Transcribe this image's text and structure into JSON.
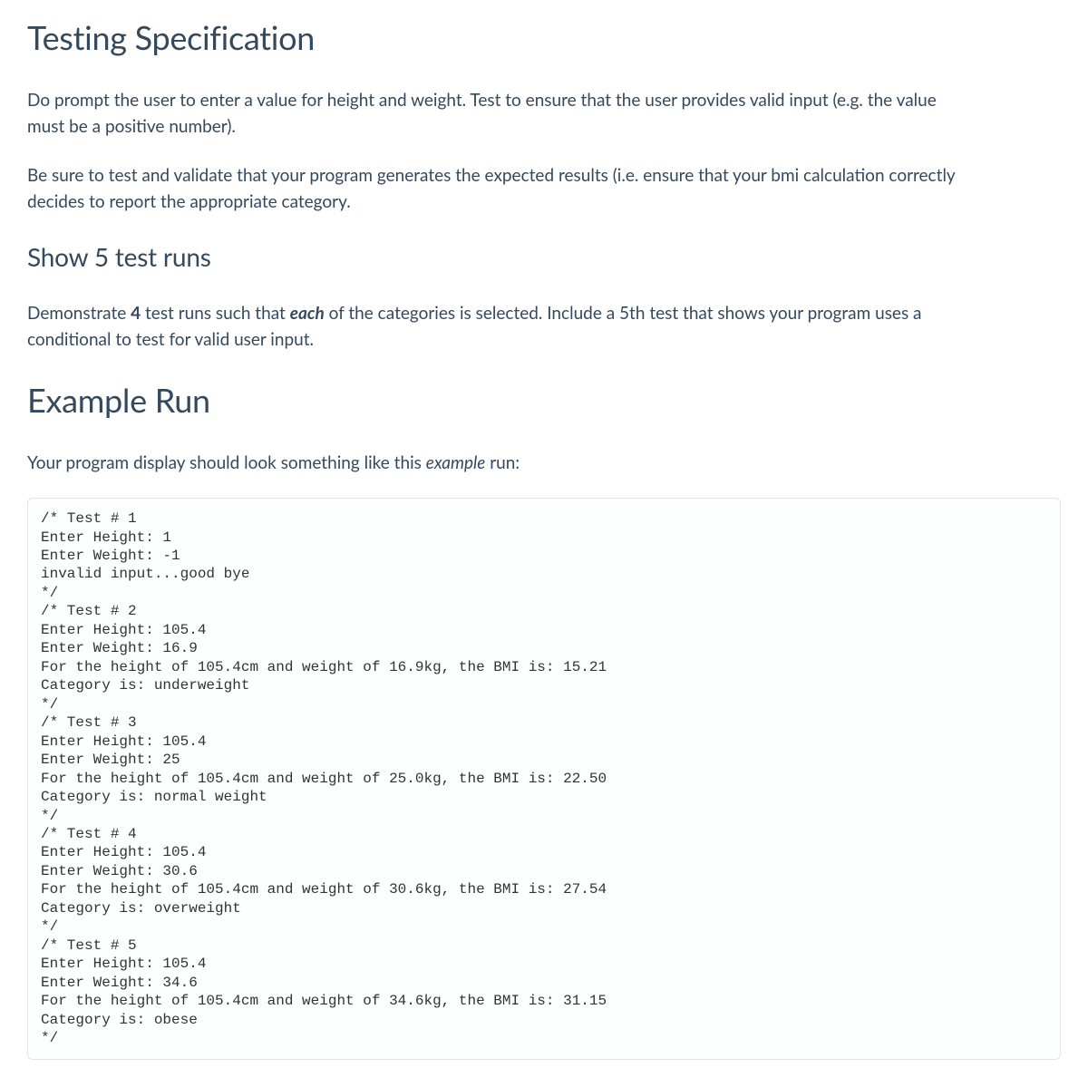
{
  "section1": {
    "heading": "Testing Specification",
    "para1_a": "Do prompt the user to enter a value for height and weight. ",
    "para1_b": "   Test to ensure that the user provides valid input (e.g. the value must be a positive number).",
    "para2": "Be sure to test and validate that your program generates the expected results (i.e. ensure that your bmi calculation correctly decides to report the appropriate category."
  },
  "section2": {
    "heading": "Show 5 test runs",
    "para1_a": "Demonstrate ",
    "para1_b": "4",
    "para1_c": " test runs such that ",
    "para1_d": "each",
    "para1_e": " of the categories is selected. Include a 5th test that shows your program uses a conditional to test for valid user input."
  },
  "section3": {
    "heading": "Example Run",
    "para1_a": "Your program display should look something like this ",
    "para1_b": "example",
    "para1_c": " run:"
  },
  "code": "/* Test # 1\nEnter Height: 1\nEnter Weight: -1\ninvalid input...good bye\n*/\n/* Test # 2\nEnter Height: 105.4\nEnter Weight: 16.9\nFor the height of 105.4cm and weight of 16.9kg, the BMI is: 15.21\nCategory is: underweight\n*/\n/* Test # 3\nEnter Height: 105.4\nEnter Weight: 25\nFor the height of 105.4cm and weight of 25.0kg, the BMI is: 22.50\nCategory is: normal weight\n*/\n/* Test # 4\nEnter Height: 105.4\nEnter Weight: 30.6\nFor the height of 105.4cm and weight of 30.6kg, the BMI is: 27.54\nCategory is: overweight\n*/\n/* Test # 5\nEnter Height: 105.4\nEnter Weight: 34.6\nFor the height of 105.4cm and weight of 34.6kg, the BMI is: 31.15\nCategory is: obese\n*/"
}
